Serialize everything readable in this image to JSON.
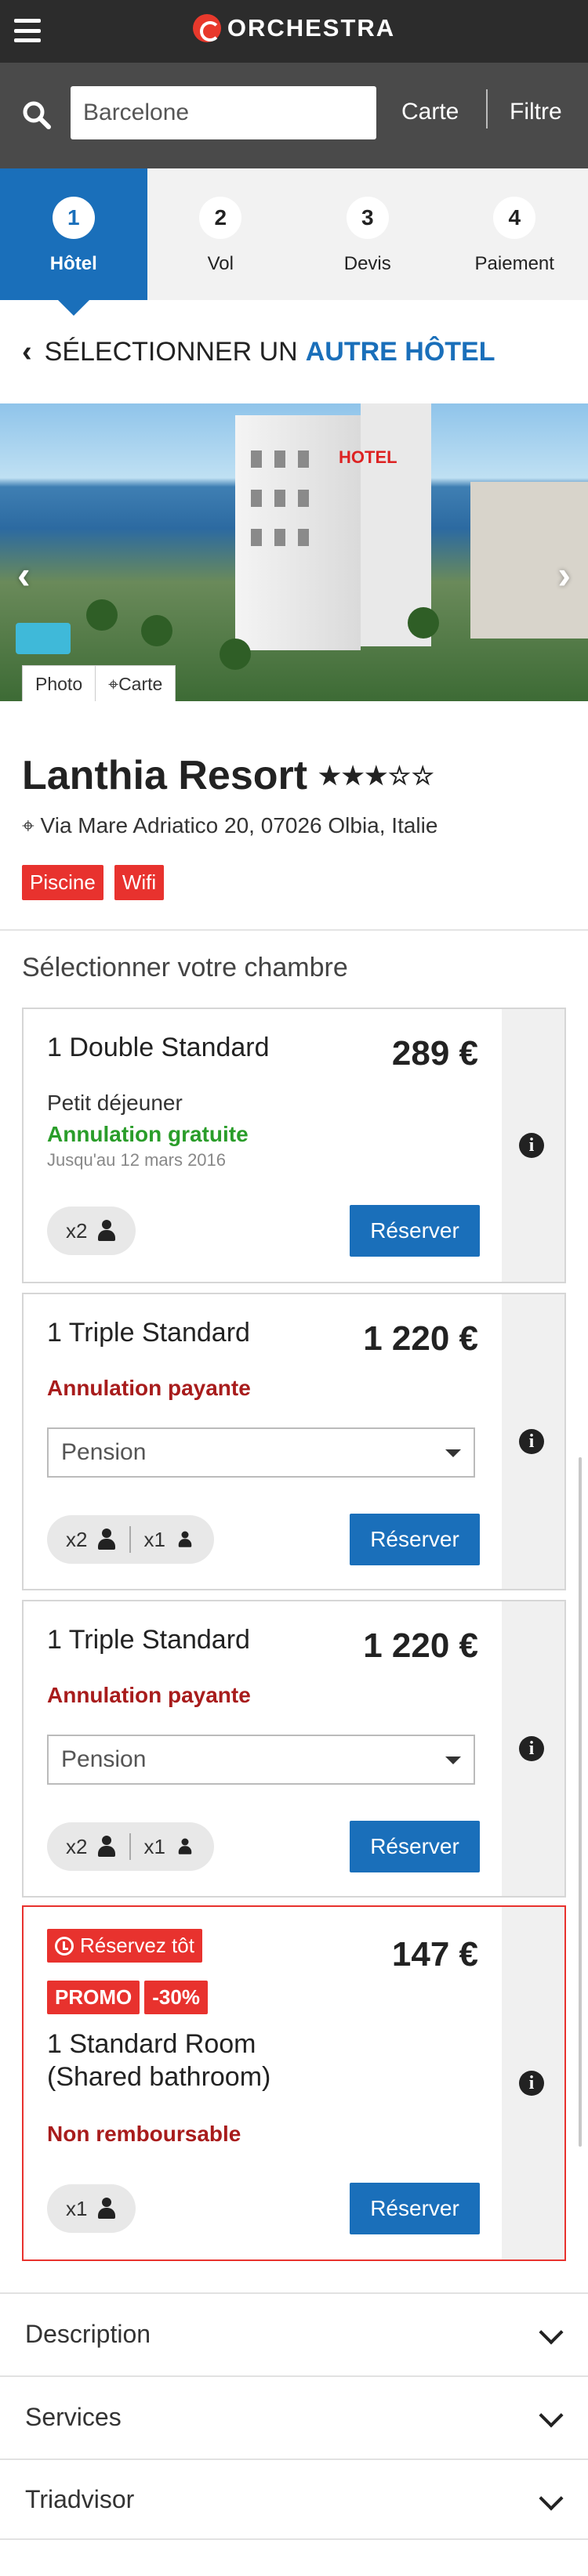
{
  "brand": {
    "name": "ORCHESTRA"
  },
  "search": {
    "value": "Barcelone",
    "carte": "Carte",
    "filtre": "Filtre"
  },
  "steps": [
    {
      "num": "1",
      "label": "Hôtel",
      "active": true
    },
    {
      "num": "2",
      "label": "Vol"
    },
    {
      "num": "3",
      "label": "Devis"
    },
    {
      "num": "4",
      "label": "Paiement"
    }
  ],
  "back": {
    "prefix": "SÉLECTIONNER UN",
    "accent": "AUTRE HÔTEL"
  },
  "hero": {
    "photo_tab": "Photo",
    "map_tab": "Carte",
    "sign": "HOTEL"
  },
  "hotel": {
    "name": "Lanthia Resort",
    "stars": "★★★☆☆",
    "rating_stars": 3,
    "address": "Via Mare Adriatico 20, 07026 Olbia, Italie",
    "tags": [
      "Piscine",
      "Wifi"
    ]
  },
  "rooms_title": "Sélectionner votre chambre",
  "rooms": [
    {
      "title": "1 Double Standard",
      "price": "289 €",
      "board": "Petit déjeuner",
      "cancel": "Annulation gratuite",
      "until": "Jusqu'au 12 mars 2016",
      "pax_adults": "x2",
      "button": "Réserver"
    },
    {
      "title": "1 Triple Standard",
      "price": "1 220 €",
      "cancel": "Annulation payante",
      "select": "Pension",
      "pax_adults": "x2",
      "pax_children": "x1",
      "button": "Réserver"
    },
    {
      "title": "1 Triple Standard",
      "price": "1 220 €",
      "cancel": "Annulation payante",
      "select": "Pension",
      "pax_adults": "x2",
      "pax_children": "x1",
      "button": "Réserver"
    },
    {
      "early": "Réservez tôt",
      "promo": "PROMO",
      "discount": "-30%",
      "price": "147 €",
      "title_line1": "1 Standard Room",
      "title_line2": "(Shared bathroom)",
      "cancel": "Non remboursable",
      "pax_adults": "x1",
      "button": "Réserver"
    }
  ],
  "accordion": [
    "Description",
    "Services",
    "Triadvisor"
  ],
  "colors": {
    "primary": "#1a6fba",
    "red": "#e8322e",
    "green": "#2a9d2a",
    "dark": "#2c2c2c"
  },
  "icons": {
    "info": "i"
  }
}
